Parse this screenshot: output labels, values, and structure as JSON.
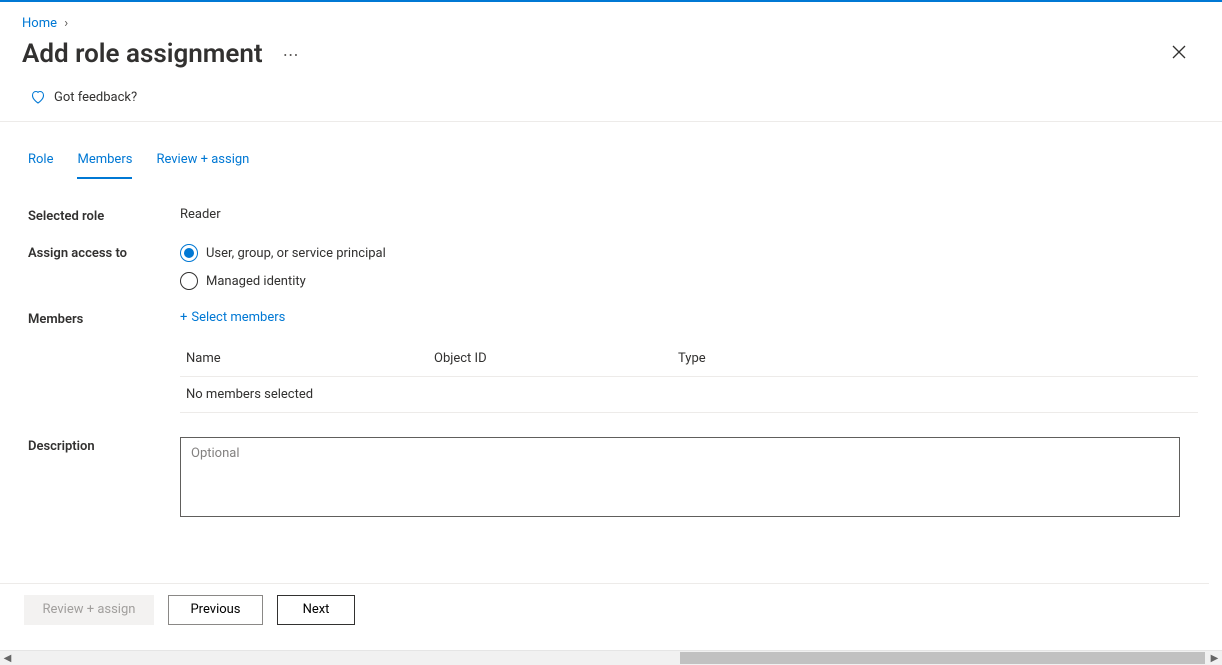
{
  "breadcrumb": {
    "home": "Home"
  },
  "page": {
    "title": "Add role assignment"
  },
  "feedback": {
    "label": "Got feedback?"
  },
  "tabs": {
    "role": "Role",
    "members": "Members",
    "review": "Review + assign"
  },
  "form": {
    "selected_role_label": "Selected role",
    "selected_role_value": "Reader",
    "assign_access_label": "Assign access to",
    "radio_user_group": "User, group, or service principal",
    "radio_managed_identity": "Managed identity",
    "members_label": "Members",
    "select_members_action": "Select members",
    "description_label": "Description",
    "description_placeholder": "Optional"
  },
  "members_table": {
    "col_name": "Name",
    "col_objectid": "Object ID",
    "col_type": "Type",
    "empty": "No members selected"
  },
  "footer": {
    "review_assign": "Review + assign",
    "previous": "Previous",
    "next": "Next"
  }
}
